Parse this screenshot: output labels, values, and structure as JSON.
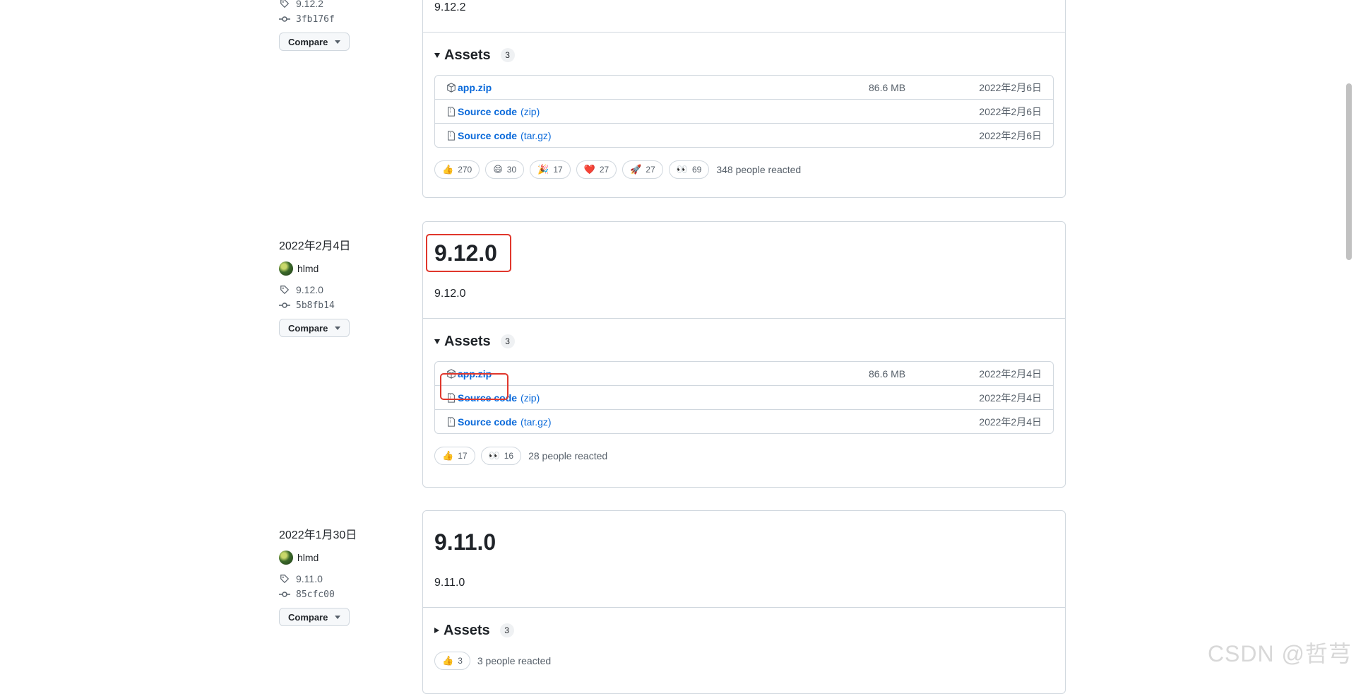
{
  "releases": [
    {
      "date": "",
      "author": "",
      "tag": "9.12.2",
      "commit": "3fb176f",
      "compare_label": "Compare",
      "title": "",
      "body": "9.12.2",
      "assets_label": "Assets",
      "assets_count": "3",
      "assets": [
        {
          "name": "app.zip",
          "ext": "",
          "size": "86.6 MB",
          "date": "2022年2月6日",
          "icon": "package-icon"
        },
        {
          "name": "Source code",
          "ext": "(zip)",
          "size": "",
          "date": "2022年2月6日",
          "icon": "file-zip-icon"
        },
        {
          "name": "Source code",
          "ext": "(tar.gz)",
          "size": "",
          "date": "2022年2月6日",
          "icon": "file-zip-icon"
        }
      ],
      "reactions": [
        {
          "emoji": "👍",
          "count": "270"
        },
        {
          "emoji": "😄",
          "count": "30"
        },
        {
          "emoji": "🎉",
          "count": "17"
        },
        {
          "emoji": "❤️",
          "count": "27"
        },
        {
          "emoji": "🚀",
          "count": "27"
        },
        {
          "emoji": "👀",
          "count": "69"
        }
      ],
      "reactions_summary": "348 people reacted"
    },
    {
      "date": "2022年2月4日",
      "author": "hlmd",
      "tag": "9.12.0",
      "commit": "5b8fb14",
      "compare_label": "Compare",
      "title": "9.12.0",
      "body": "9.12.0",
      "assets_label": "Assets",
      "assets_count": "3",
      "assets": [
        {
          "name": "app.zip",
          "ext": "",
          "size": "86.6 MB",
          "date": "2022年2月4日",
          "icon": "package-icon"
        },
        {
          "name": "Source code",
          "ext": "(zip)",
          "size": "",
          "date": "2022年2月4日",
          "icon": "file-zip-icon"
        },
        {
          "name": "Source code",
          "ext": "(tar.gz)",
          "size": "",
          "date": "2022年2月4日",
          "icon": "file-zip-icon"
        }
      ],
      "reactions": [
        {
          "emoji": "👍",
          "count": "17"
        },
        {
          "emoji": "👀",
          "count": "16"
        }
      ],
      "reactions_summary": "28 people reacted"
    },
    {
      "date": "2022年1月30日",
      "author": "hlmd",
      "tag": "9.11.0",
      "commit": "85cfc00",
      "compare_label": "Compare",
      "title": "9.11.0",
      "body": "9.11.0",
      "assets_label": "Assets",
      "assets_count": "3",
      "reactions": [
        {
          "emoji": "👍",
          "count": "3"
        }
      ],
      "reactions_summary": "3 people reacted"
    }
  ],
  "watermark": "CSDN @哲芎",
  "colors": {
    "link": "#0969da",
    "highlight": "#e0372c",
    "border": "#d0d7de"
  }
}
